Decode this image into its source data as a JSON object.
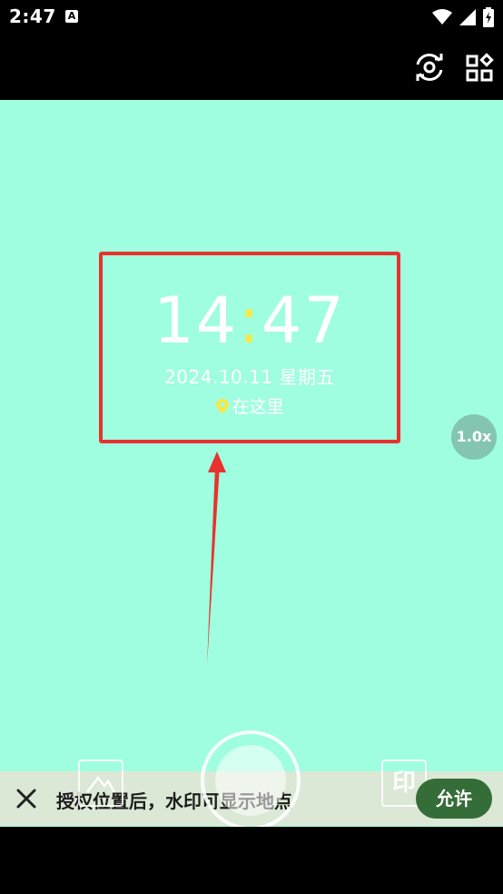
{
  "status_bar": {
    "time": "2:47",
    "notification_icon": "a-letter-icon",
    "icons": [
      "wifi-icon",
      "signal-icon",
      "battery-charging-icon"
    ]
  },
  "top_bar": {
    "icons": [
      "switch-camera-icon",
      "apps-grid-icon"
    ]
  },
  "watermark": {
    "hour": "14",
    "colon": ":",
    "minute": "47",
    "date": "2024.10.11 星期五",
    "location": "在这里",
    "accent_color": "#f6e84a"
  },
  "zoom": {
    "label": "1.0x"
  },
  "permission_banner": {
    "message": "授权位置后，水印可显示地点",
    "allow_label": "允许"
  },
  "controls": {
    "stamp_label": "印"
  },
  "colors": {
    "viewfinder": "#9ffedf",
    "highlight_box": "#e8322d",
    "allow_button": "#356d38"
  }
}
